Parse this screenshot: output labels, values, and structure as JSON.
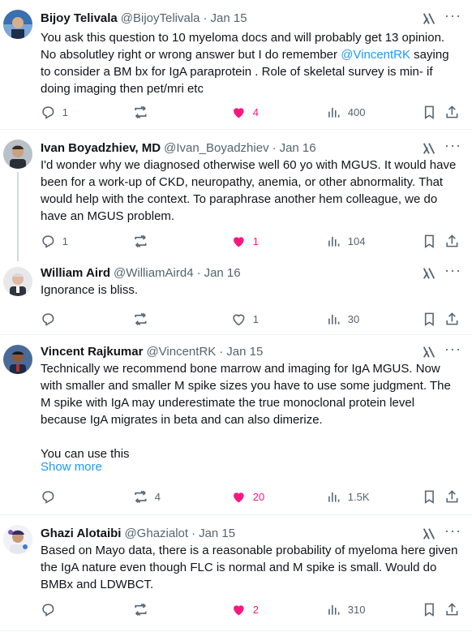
{
  "tweets": [
    {
      "name": "Bijoy Telivala",
      "handle": "@BijoyTelivala",
      "date": "Jan 15",
      "text_before": "You ask this question to 10 myeloma docs and will probably get 13 opinion. No absolutley right or wrong answer but I do remember ",
      "mention": "@VincentRK",
      "text_after": " saying to consider a BM bx for IgA paraprotein . Role of skeletal survey is min- if doing imaging then pet/mri etc",
      "replies": "1",
      "retweets": "",
      "likes": "4",
      "views": "400",
      "liked": true
    },
    {
      "name": "Ivan Boyadzhiev, MD",
      "handle": "@Ivan_Boyadzhiev",
      "date": "Jan 16",
      "text": "I'd wonder why we diagnosed otherwise well 60 yo with MGUS. It would have been for a work-up of CKD, neuropathy, anemia, or other abnormality. That would help with the context. To paraphrase another hem colleague, we do have an MGUS problem.",
      "replies": "1",
      "retweets": "",
      "likes": "1",
      "views": "104",
      "liked": true
    },
    {
      "name": "William Aird",
      "handle": "@WilliamAird4",
      "date": "Jan 16",
      "text": "Ignorance is bliss.",
      "replies": "",
      "retweets": "",
      "likes": "1",
      "views": "30",
      "liked": false
    },
    {
      "name": "Vincent Rajkumar",
      "handle": "@VincentRK",
      "date": "Jan 15",
      "text": "Technically we recommend bone marrow and imaging for IgA MGUS. Now with smaller and smaller M spike sizes you have to use some judgment. The M spike with IgA may underestimate the true monoclonal protein level because IgA migrates in beta and can also dimerize.\n\nYou can use this",
      "show_more": "Show more",
      "replies": "",
      "retweets": "4",
      "likes": "20",
      "views": "1.5K",
      "liked": true
    },
    {
      "name": "Ghazi Alotaibi",
      "handle": "@Ghazialot",
      "date": "Jan 15",
      "text": "Based on Mayo data, there is a reasonable probability of myeloma here given the IgA nature even though FLC is normal and M spike is small. Would do BMBx and LDWBCT.",
      "replies": "",
      "retweets": "",
      "likes": "2",
      "views": "310",
      "liked": true
    }
  ],
  "colors": {
    "text": "#0f1419",
    "secondary": "#536471",
    "link": "#1d9bf0",
    "like": "#f91880",
    "divider": "#eff3f4"
  }
}
